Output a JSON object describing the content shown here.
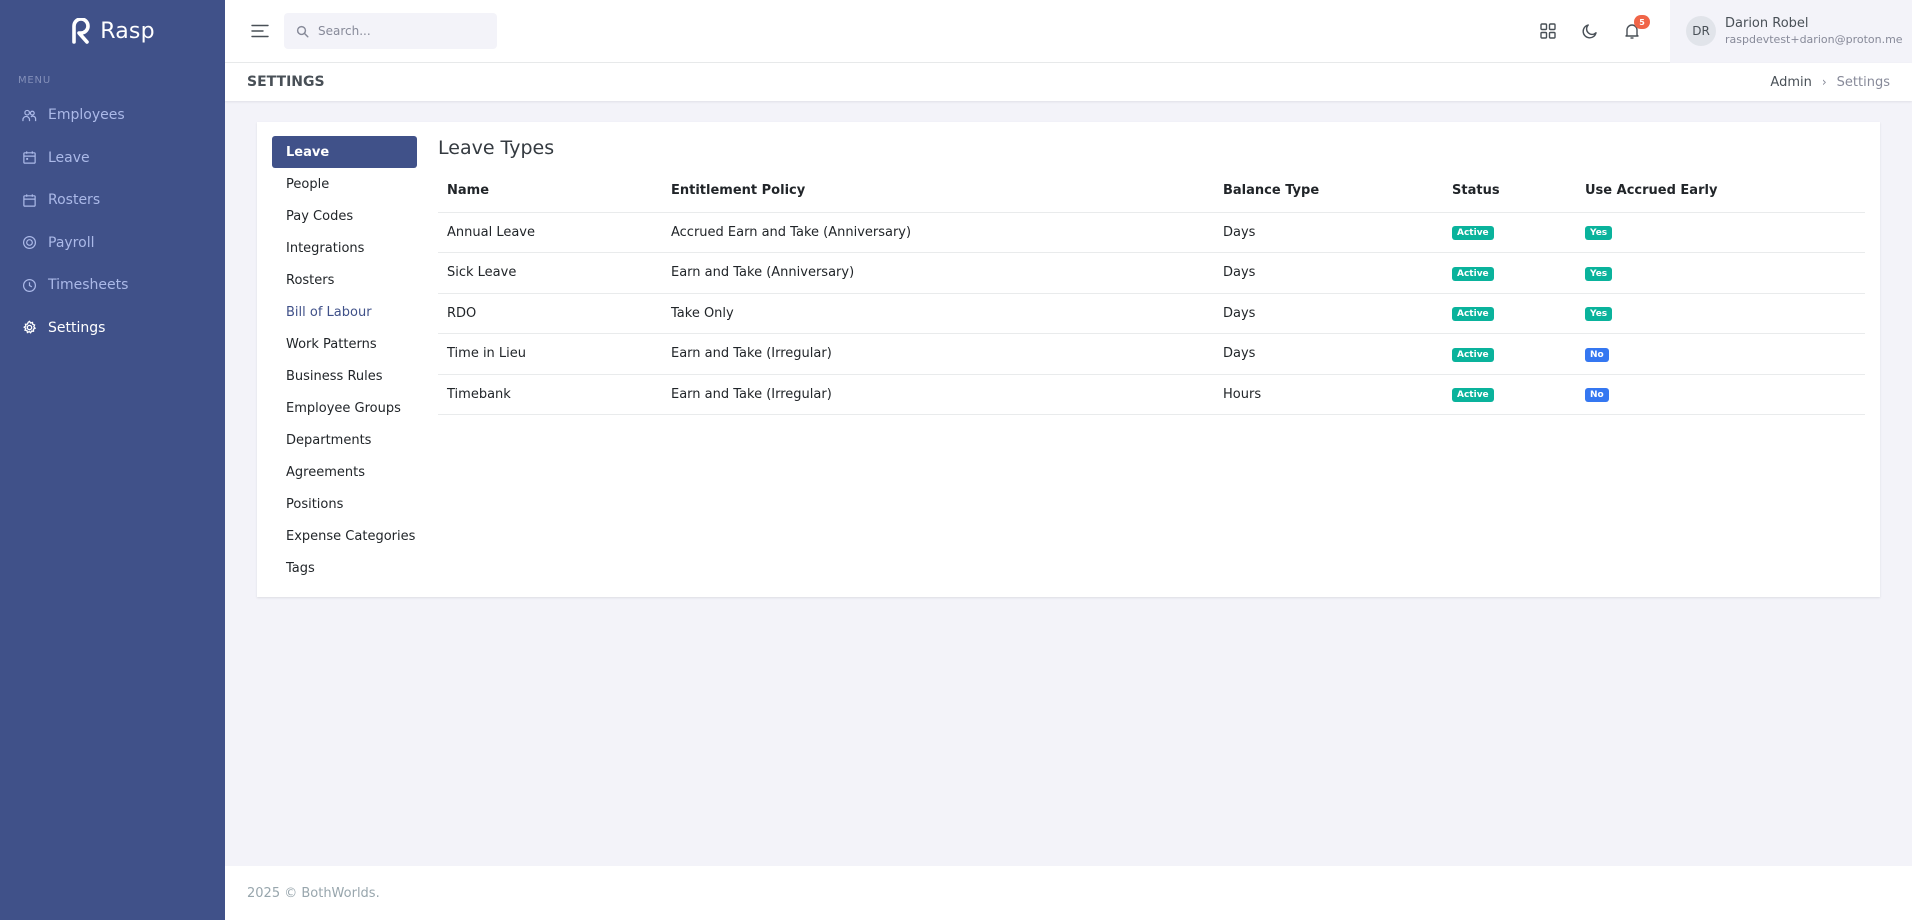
{
  "app": {
    "brand_name": "Rasp",
    "menu_title": "Menu"
  },
  "sidebar": {
    "items": [
      {
        "label": "Employees",
        "icon": "users-icon",
        "active": false
      },
      {
        "label": "Leave",
        "icon": "calendar-icon",
        "active": false
      },
      {
        "label": "Rosters",
        "icon": "calendar-grid-icon",
        "active": false
      },
      {
        "label": "Payroll",
        "icon": "dollar-circle-icon",
        "active": false
      },
      {
        "label": "Timesheets",
        "icon": "clock-icon",
        "active": false
      },
      {
        "label": "Settings",
        "icon": "gear-icon",
        "active": true
      }
    ]
  },
  "topbar": {
    "search_placeholder": "Search...",
    "notification_count": "5",
    "user": {
      "initials": "DR",
      "name": "Darion Robel",
      "email": "raspdevtest+darion@proton.me"
    }
  },
  "page": {
    "title": "SETTINGS",
    "breadcrumb": {
      "parent": "Admin",
      "current": "Settings"
    }
  },
  "settings_nav": {
    "items": [
      {
        "label": "Leave",
        "active": true
      },
      {
        "label": "People"
      },
      {
        "label": "Pay Codes"
      },
      {
        "label": "Integrations"
      },
      {
        "label": "Rosters"
      },
      {
        "label": "Bill of Labour",
        "link": true
      },
      {
        "label": "Work Patterns"
      },
      {
        "label": "Business Rules"
      },
      {
        "label": "Employee Groups"
      },
      {
        "label": "Departments"
      },
      {
        "label": "Agreements"
      },
      {
        "label": "Positions"
      },
      {
        "label": "Expense Categories"
      },
      {
        "label": "Tags"
      }
    ]
  },
  "leave_types": {
    "title": "Leave Types",
    "columns": [
      "Name",
      "Entitlement Policy",
      "Balance Type",
      "Status",
      "Use Accrued Early"
    ],
    "rows": [
      {
        "name": "Annual Leave",
        "policy": "Accrued Earn and Take (Anniversary)",
        "balance_type": "Days",
        "status": "Active",
        "use_accrued_early": "Yes"
      },
      {
        "name": "Sick Leave",
        "policy": "Earn and Take (Anniversary)",
        "balance_type": "Days",
        "status": "Active",
        "use_accrued_early": "Yes"
      },
      {
        "name": "RDO",
        "policy": "Take Only",
        "balance_type": "Days",
        "status": "Active",
        "use_accrued_early": "Yes"
      },
      {
        "name": "Time in Lieu",
        "policy": "Earn and Take (Irregular)",
        "balance_type": "Days",
        "status": "Active",
        "use_accrued_early": "No"
      },
      {
        "name": "Timebank",
        "policy": "Earn and Take (Irregular)",
        "balance_type": "Hours",
        "status": "Active",
        "use_accrued_early": "No"
      }
    ]
  },
  "footer": {
    "text": "2025 © BothWorlds."
  },
  "colors": {
    "sidebar_bg": "#405189",
    "active_green": "#0ab39c",
    "no_blue": "#3577f1",
    "notification_red": "#f06548"
  }
}
